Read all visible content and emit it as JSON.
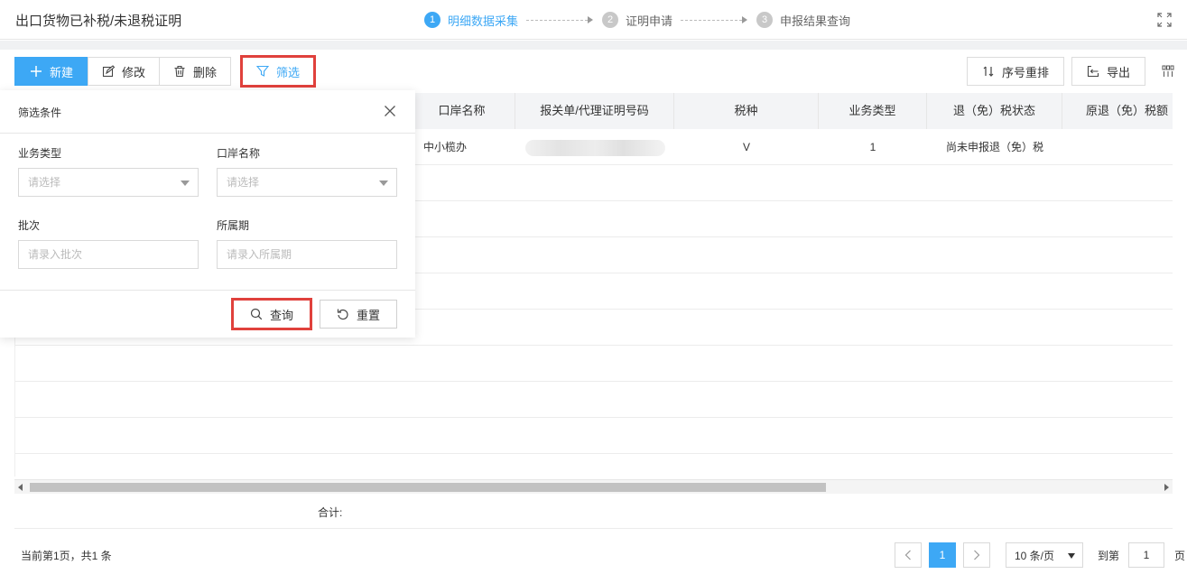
{
  "header": {
    "title": "出口货物已补税/未退税证明",
    "steps": [
      {
        "num": "1",
        "label": "明细数据采集"
      },
      {
        "num": "2",
        "label": "证明申请"
      },
      {
        "num": "3",
        "label": "申报结果查询"
      }
    ],
    "expand_icon": "fullscreen-icon"
  },
  "toolbar": {
    "new_label": "新建",
    "edit_label": "修改",
    "delete_label": "删除",
    "filter_label": "筛选",
    "sort_label": "序号重排",
    "export_label": "导出"
  },
  "table": {
    "columns": [
      "口岸名称",
      "报关单/代理证明号码",
      "税种",
      "业务类型",
      "退（免）税状态",
      "原退（免）税额"
    ],
    "rows": [
      {
        "port": "中小榄办",
        "customs_no": "",
        "tax_type": "V",
        "biz_type": "1",
        "status": "尚未申报退（免）税",
        "orig_amount": ""
      }
    ],
    "sum_label": "合计:"
  },
  "filter": {
    "title": "筛选条件",
    "biz_type_label": "业务类型",
    "biz_type_placeholder": "请选择",
    "port_label": "口岸名称",
    "port_placeholder": "请选择",
    "batch_label": "批次",
    "batch_placeholder": "请录入批次",
    "period_label": "所属期",
    "period_placeholder": "请录入所属期",
    "query_label": "查询",
    "reset_label": "重置"
  },
  "pagination": {
    "info": "当前第1页，共1 条",
    "current_page": "1",
    "page_size": "10 条/页",
    "goto_label": "到第",
    "goto_value": "1",
    "goto_unit": "页"
  },
  "colors": {
    "accent": "#3da8f5",
    "highlight": "#e0413c"
  }
}
